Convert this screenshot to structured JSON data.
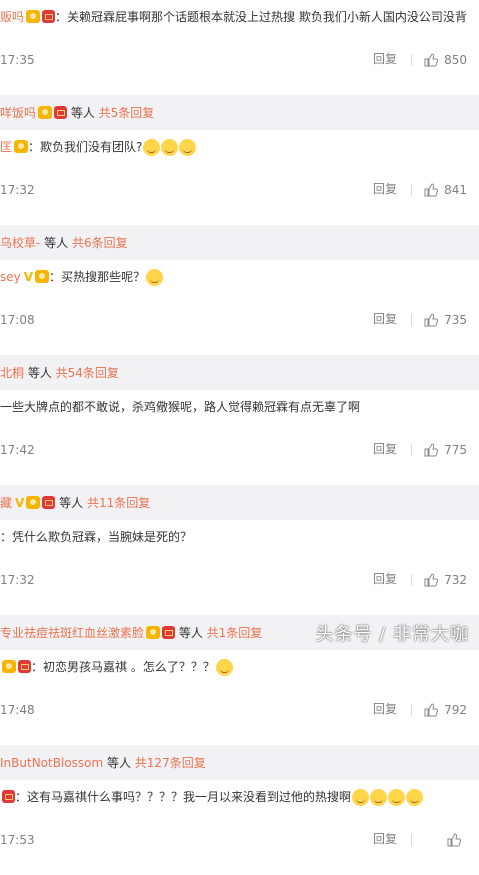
{
  "comments": [
    {
      "user": "贩吗",
      "badges": [
        "vip",
        "red"
      ],
      "text": "关赖冠霖屁事啊那个话题根本就没上过热搜 欺负我们小新人国内没公司没背",
      "time": "17:35",
      "likes": "850",
      "emoji_count": 0
    },
    {
      "user": "匡",
      "badges": [
        "vip"
      ],
      "text": "欺负我们没有团队?",
      "time": "17:32",
      "likes": "841",
      "emoji_count": 3
    },
    {
      "user": "sey",
      "badges": [
        "v",
        "vip"
      ],
      "text": "买热搜那些呢？",
      "time": "17:08",
      "likes": "735",
      "emoji_count": 1
    },
    {
      "user": "",
      "badges": [],
      "text": "一些大牌点的都不敢说，杀鸡儆猴呢，路人觉得赖冠霖有点无辜了啊",
      "time": "17:42",
      "likes": "775",
      "emoji_count": 0
    },
    {
      "user": "",
      "badges": [],
      "text": "：凭什么欺负冠霖，当腕妹是死的？",
      "time": "17:32",
      "likes": "732",
      "emoji_count": 0
    },
    {
      "user": "",
      "badges": [
        "vip",
        "red"
      ],
      "text": "初恋男孩马嘉祺 。怎么了？？？",
      "time": "17:48",
      "likes": "792",
      "emoji_count": 1
    },
    {
      "user": "",
      "badges": [
        "red"
      ],
      "text": "这有马嘉祺什么事吗？？？？我一月以来没看到过他的热搜啊",
      "time": "17:53",
      "likes": "",
      "emoji_count": 4
    }
  ],
  "reply_bars": [
    {
      "user": "咩饭吗",
      "badges": [
        "vip",
        "red"
      ],
      "suffix": "等人",
      "more": "共5条回复"
    },
    {
      "user": "乌校草-",
      "badges": [],
      "suffix": "等人",
      "more": "共6条回复"
    },
    {
      "user": "北桐",
      "badges": [],
      "suffix": "等人",
      "more": "共54条回复"
    },
    {
      "user": "藏",
      "badges": [
        "v",
        "vip",
        "red"
      ],
      "suffix": "等人",
      "more": "共11条回复"
    },
    {
      "user": "专业祛痘祛斑红血丝激素脸",
      "badges": [
        "vip",
        "red"
      ],
      "suffix": "等人",
      "more": "共1条回复"
    },
    {
      "user": "InButNotBlossom",
      "badges": [],
      "suffix": "等人",
      "more": "共127条回复"
    }
  ],
  "labels": {
    "reply": "回复",
    "separator": "："
  },
  "watermark": "头条号 / 非常大咖",
  "colors": {
    "username": "#eb7350",
    "meta": "#808080",
    "reply_bg": "#f2f2f5"
  }
}
